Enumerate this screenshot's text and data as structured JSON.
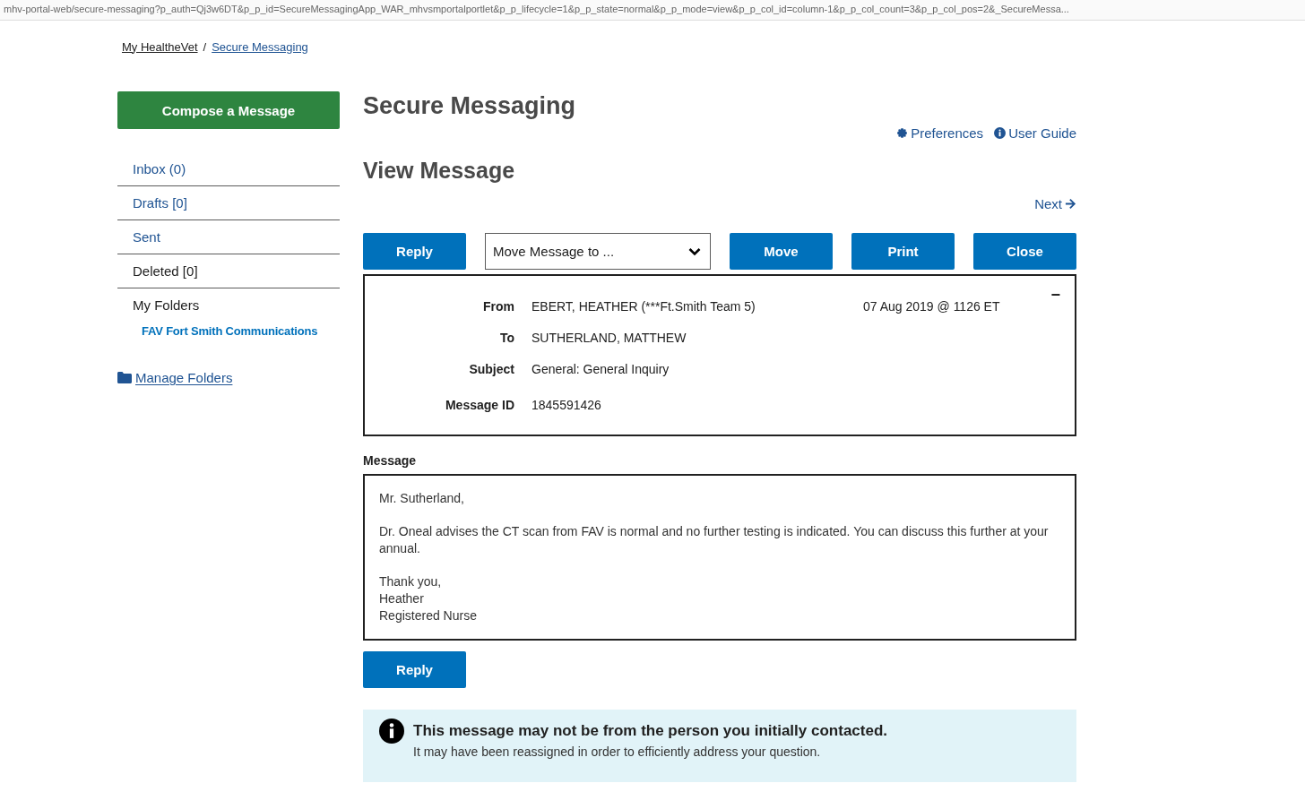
{
  "address_bar": {
    "url": "mhv-portal-web/secure-messaging?p_auth=Qj3w6DT&p_p_id=SecureMessagingApp_WAR_mhvsmportalportlet&p_p_lifecycle=1&p_p_state=normal&p_p_mode=view&p_p_col_id=column-1&p_p_col_count=3&p_p_col_pos=2&_SecureMessa..."
  },
  "breadcrumb": {
    "links": [
      "My HealtheVet",
      "Secure Messaging"
    ],
    "separator": "/"
  },
  "sidebar": {
    "compose_button": "Compose a Message",
    "items": [
      {
        "label": "Inbox (0)",
        "kind": "link"
      },
      {
        "label": "Drafts [0]",
        "kind": "link"
      },
      {
        "label": "Sent",
        "kind": "link"
      },
      {
        "label": "Deleted [0]",
        "kind": "plain"
      },
      {
        "label": "My Folders",
        "kind": "heading",
        "children": [
          {
            "label": "FAV Fort Smith Communications",
            "kind": "link"
          }
        ]
      }
    ],
    "manage_folders": "Manage Folders"
  },
  "main": {
    "title": "Secure Messaging",
    "top_links": [
      {
        "label": "Preferences",
        "kind": "gear"
      },
      {
        "label": "User Guide",
        "kind": "info"
      }
    ],
    "subtitle": "View Message",
    "next_link": "Next",
    "toolbar": [
      {
        "kind": "button",
        "label": "Reply"
      },
      {
        "kind": "select",
        "label": "Move Message to ..."
      },
      {
        "kind": "button",
        "label": "Move"
      },
      {
        "kind": "button",
        "label": "Print"
      },
      {
        "kind": "button",
        "label": "Close"
      }
    ],
    "header_fields": [
      {
        "label": "From",
        "value": "EBERT, HEATHER (***Ft.Smith Team 5)",
        "date": "07 Aug 2019 @ 1126 ET"
      },
      {
        "label": "To",
        "value": "SUTHERLAND, MATTHEW"
      },
      {
        "label": "Subject",
        "value": "General: General Inquiry"
      },
      {
        "label": "Message ID",
        "value": "1845591426"
      }
    ],
    "collapse_button": "−",
    "message_label": "Message",
    "message_paragraphs": [
      [
        "Mr. Sutherland,"
      ],
      [
        "Dr. Oneal advises the CT scan from FAV is normal and no further testing is indicated. You can discuss this further at your annual."
      ],
      [
        "Thank you,",
        "Heather",
        "Registered Nurse"
      ]
    ],
    "reply_button": "Reply",
    "notice": {
      "title": "This message may not be from the person you initially contacted.",
      "text": "It may have been reassigned in order to efficiently address your question."
    }
  }
}
